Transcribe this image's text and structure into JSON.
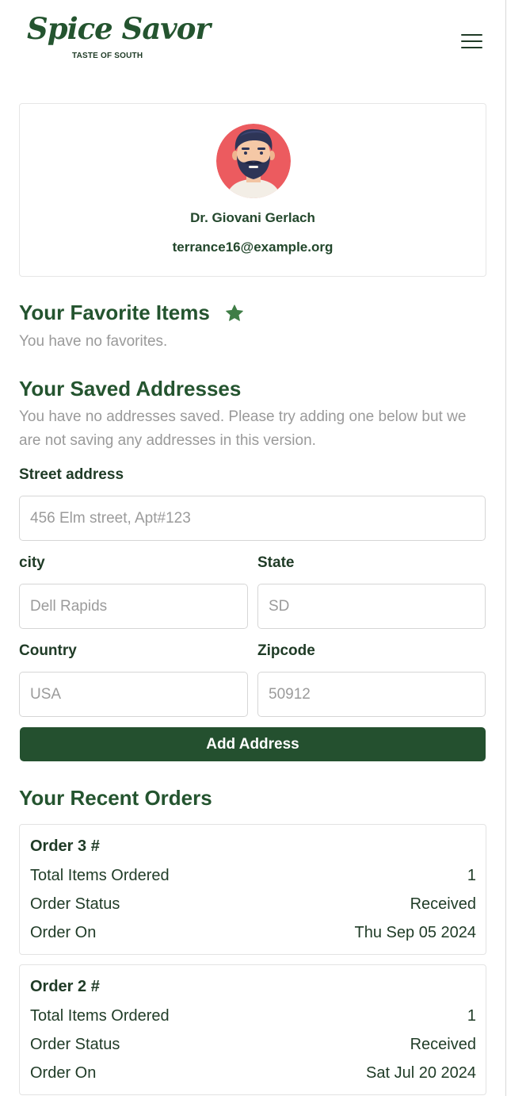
{
  "brand": {
    "name": "Spice Savor",
    "tagline": "TASTE OF SOUTH",
    "color": "#24542f"
  },
  "header": {
    "menu_icon": "hamburger-menu-icon"
  },
  "profile": {
    "name": "Dr. Giovani Gerlach",
    "email": "terrance16@example.org",
    "avatar_icon": "bearded-man-avatar"
  },
  "favorites": {
    "heading": "Your Favorite Items",
    "icon": "star-icon",
    "empty_text": "You have no favorites."
  },
  "addresses": {
    "heading": "Your Saved Addresses",
    "empty_text": "You have no addresses saved. Please try adding one below but we are not saving any addresses in this version.",
    "form": {
      "street_label": "Street address",
      "street_placeholder": "456 Elm street, Apt#123",
      "city_label": "city",
      "city_placeholder": "Dell Rapids",
      "state_label": "State",
      "state_placeholder": "SD",
      "country_label": "Country",
      "country_placeholder": "USA",
      "zip_label": "Zipcode",
      "zip_placeholder": "50912",
      "submit_label": "Add Address"
    }
  },
  "orders": {
    "heading": "Your Recent Orders",
    "list": [
      {
        "title": "Order 3 #",
        "items_label": "Total Items Ordered",
        "items_value": "1",
        "status_label": "Order Status",
        "status_value": "Received",
        "date_label": "Order On",
        "date_value": "Thu Sep 05 2024"
      },
      {
        "title": "Order 2 #",
        "items_label": "Total Items Ordered",
        "items_value": "1",
        "status_label": "Order Status",
        "status_value": "Received",
        "date_label": "Order On",
        "date_value": "Sat Jul 20 2024"
      }
    ]
  }
}
